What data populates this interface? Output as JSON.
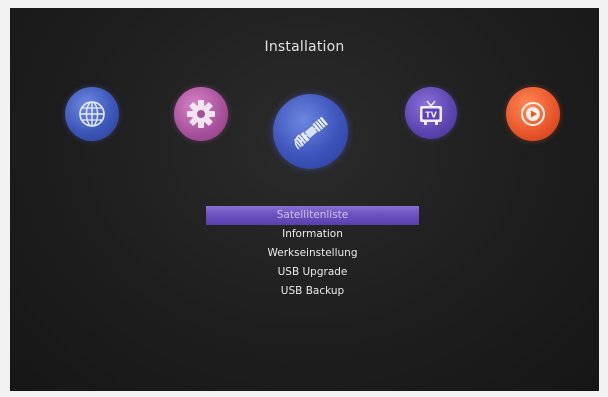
{
  "screen": {
    "title": "Installation"
  },
  "icons": [
    {
      "name": "globe-icon",
      "color": "#3c57b8"
    },
    {
      "name": "gear-icon",
      "color": "#a6509a"
    },
    {
      "name": "satellite-icon",
      "color": "#3c54bb"
    },
    {
      "name": "tv-icon",
      "color": "#5b44b0"
    },
    {
      "name": "play-icon",
      "color": "#e8532a"
    }
  ],
  "menu": {
    "items": [
      {
        "label": "Satellitenliste",
        "selected": true
      },
      {
        "label": "Information",
        "selected": false
      },
      {
        "label": "Werkseinstellung",
        "selected": false
      },
      {
        "label": "USB Upgrade",
        "selected": false
      },
      {
        "label": "USB Backup",
        "selected": false
      }
    ]
  },
  "colors": {
    "highlight": "#6a4fbe",
    "background": "#1e1e1e",
    "text": "#ececec"
  }
}
